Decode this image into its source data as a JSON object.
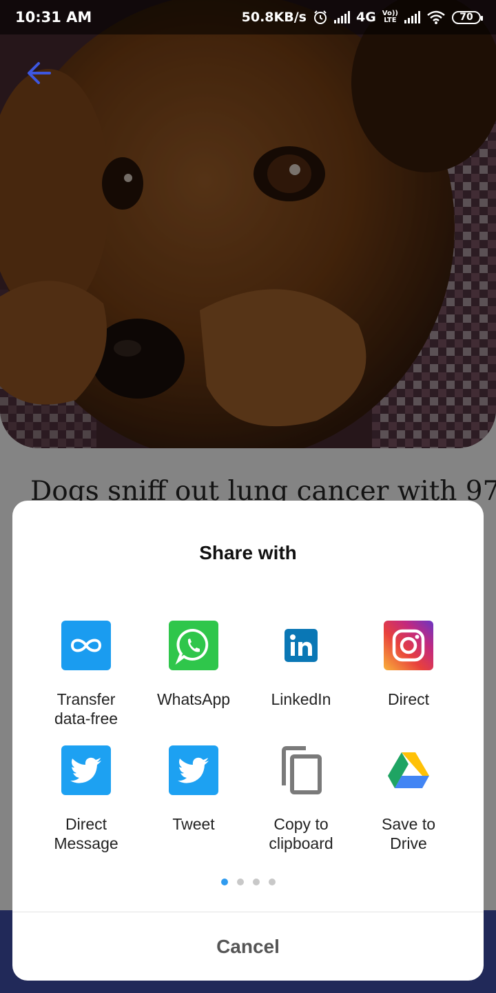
{
  "status_bar": {
    "time": "10:31 AM",
    "speed": "50.8KB/s",
    "network": "4G",
    "volte_top": "Vo))",
    "volte_bottom": "LTE",
    "battery": "70",
    "icons": [
      "alarm-icon",
      "signal-icon",
      "wifi-icon",
      "battery-icon"
    ]
  },
  "header": {
    "back_icon": "back-arrow-icon",
    "accent": "#3d57e0"
  },
  "article": {
    "title": "Dogs sniff out lung cancer with 97"
  },
  "share_sheet": {
    "title": "Share with",
    "apps": [
      {
        "label_1": "Transfer",
        "label_2": "data-free",
        "icon": "mi-drop-icon",
        "color": "#1a9cf0"
      },
      {
        "label_1": "WhatsApp",
        "label_2": "",
        "icon": "whatsapp-icon",
        "color": "#2fc64b"
      },
      {
        "label_1": "LinkedIn",
        "label_2": "",
        "icon": "linkedin-icon",
        "color": "#0a77b5"
      },
      {
        "label_1": "Direct",
        "label_2": "",
        "icon": "instagram-icon",
        "color": "#d6327a"
      },
      {
        "label_1": "Direct",
        "label_2": "Message",
        "icon": "twitter-icon",
        "color": "#1da1f2"
      },
      {
        "label_1": "Tweet",
        "label_2": "",
        "icon": "twitter-icon",
        "color": "#1da1f2"
      },
      {
        "label_1": "Copy to",
        "label_2": "clipboard",
        "icon": "copy-icon",
        "color": "#777777"
      },
      {
        "label_1": "Save to",
        "label_2": "Drive",
        "icon": "google-drive-icon",
        "color": "#1fa463"
      }
    ],
    "page_count": 4,
    "active_page": 1,
    "cancel_label": "Cancel"
  }
}
